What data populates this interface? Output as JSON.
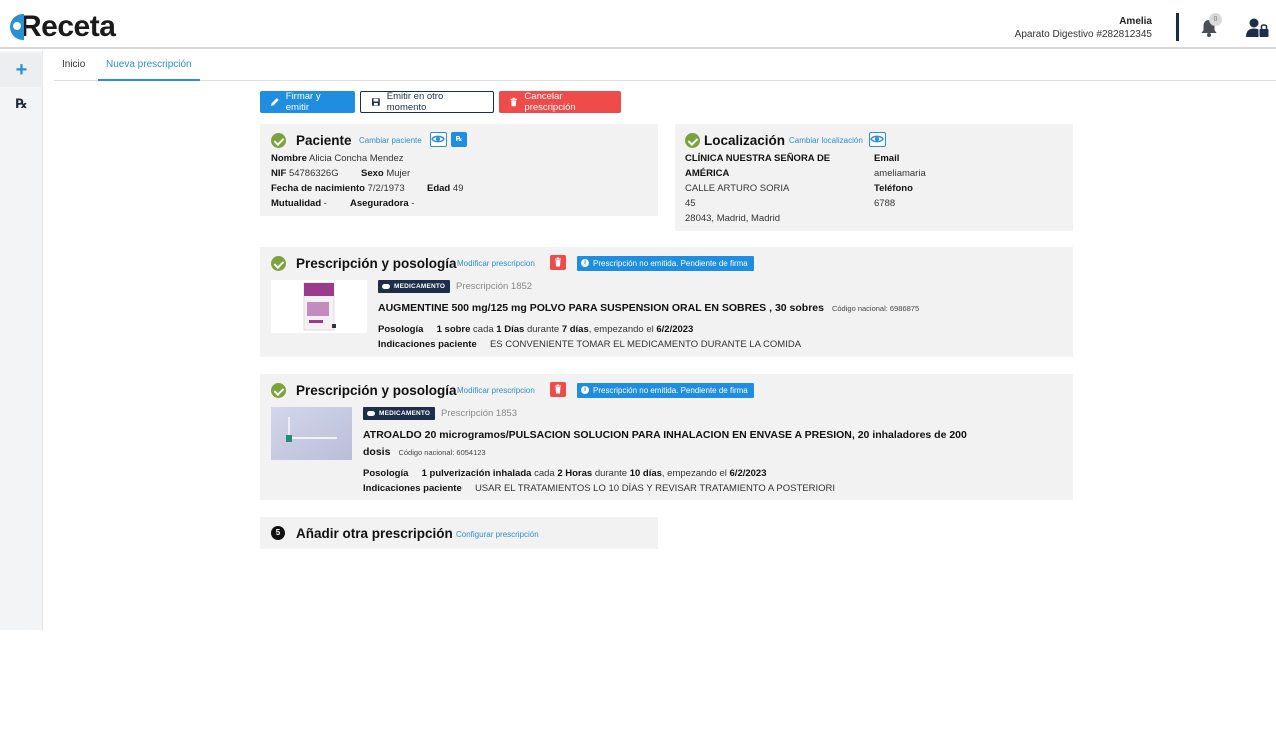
{
  "header": {
    "logo": "Receta",
    "user_name": "Amelia",
    "user_sub": "Aparato Digestivo #282812345",
    "notification_count": "0"
  },
  "sidebar": {
    "plus": "+",
    "rx": "℞"
  },
  "tabs": [
    {
      "label": "Inicio"
    },
    {
      "label": "Nueva prescripción"
    }
  ],
  "actions": {
    "sign": "Firmar y emitir",
    "later": "Emitir en otro momento",
    "cancel": "Cancelar prescripción"
  },
  "patient": {
    "title": "Paciente",
    "change": "Cambiar paciente",
    "rx": "℞",
    "name_label": "Nombre",
    "name": "Alicia Concha Mendez",
    "nif_label": "NIF",
    "nif": "54786326G",
    "sex_label": "Sexo",
    "sex": "Mujer",
    "dob_label": "Fecha de nacimiento",
    "dob": "7/2/1973",
    "age_label": "Edad",
    "age": "49",
    "mutual_label": "Mutualidad",
    "mutual": "-",
    "insurer_label": "Aseguradora",
    "insurer": "-"
  },
  "location": {
    "title": "Localización",
    "change": "Cambiar localización",
    "clinic_line1": "CLÍNICA NUESTRA SEÑORA DE",
    "clinic_line2": "AMÉRICA",
    "street": "CALLE ARTURO SORIA",
    "number": "45",
    "city": "28043, Madrid, Madrid",
    "email_label": "Email",
    "email": "ameliamaria",
    "phone_label": "Teléfono",
    "phone": "6788"
  },
  "prescriptions": [
    {
      "title": "Prescripción y posología",
      "modify": "Modificar prescripcion",
      "status": "Prescripción no emitida. Pendiente de firma",
      "tag": "MEDICAMENTO",
      "number": "Prescripción 1852",
      "name": "AUGMENTINE 500 mg/125 mg POLVO PARA SUSPENSION ORAL EN SOBRES , 30 sobres",
      "cn": "Código nacional: 6986875",
      "posology_label": "Posología",
      "dose": "1 sobre",
      "every": "cada",
      "interval": "1 Días",
      "during": "durante",
      "duration": "7 días",
      "starting": ", empezando el",
      "start": "6/2/2023",
      "indications_label": "Indicaciones paciente",
      "indications": "ES CONVENIENTE TOMAR EL MEDICAMENTO DURANTE LA COMIDA"
    },
    {
      "title": "Prescripción y posología",
      "modify": "Modificar prescripcion",
      "status": "Prescripción no emitida. Pendiente de firma",
      "tag": "MEDICAMENTO",
      "number": "Prescripción 1853",
      "name_line1": "ATROALDO 20 microgramos/PULSACION SOLUCION PARA INHALACION EN ENVASE A PRESION, 20 inhaladores de 200",
      "name_line2": "dosis",
      "cn": "Código nacional: 6054123",
      "posology_label": "Posología",
      "dose": "1 pulverización inhalada",
      "every": "cada",
      "interval": "2 Horas",
      "during": "durante",
      "duration": "10 días",
      "starting": ", empezando el",
      "start": "6/2/2023",
      "indications_label": "Indicaciones paciente",
      "indications": "USAR EL TRATAMIENTOS LO 10 DÍAS Y REVISAR TRATAMIENTO A POSTERIORI"
    }
  ],
  "add": {
    "step": "5",
    "title": "Añadir otra prescripción",
    "configure": "Configurar prescripción"
  }
}
